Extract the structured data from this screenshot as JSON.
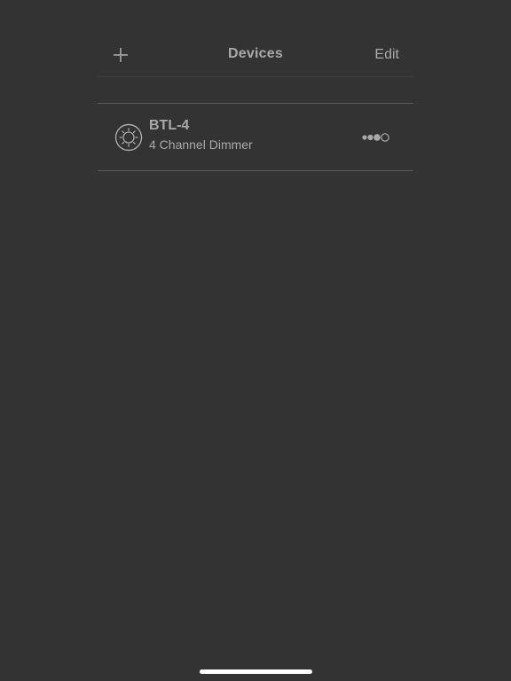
{
  "navbar": {
    "title": "Devices",
    "edit_label": "Edit",
    "add_icon": "plus-icon"
  },
  "devices": [
    {
      "name": "BTL-4",
      "description": "4 Channel Dimmer",
      "icon": "light-bulb-sun-icon",
      "signal_level": 3,
      "signal_max": 4
    }
  ],
  "colors": {
    "background": "#333333",
    "text": "#a9a9a9",
    "separator": "#5a5a5a",
    "home_indicator": "#ffffff"
  }
}
